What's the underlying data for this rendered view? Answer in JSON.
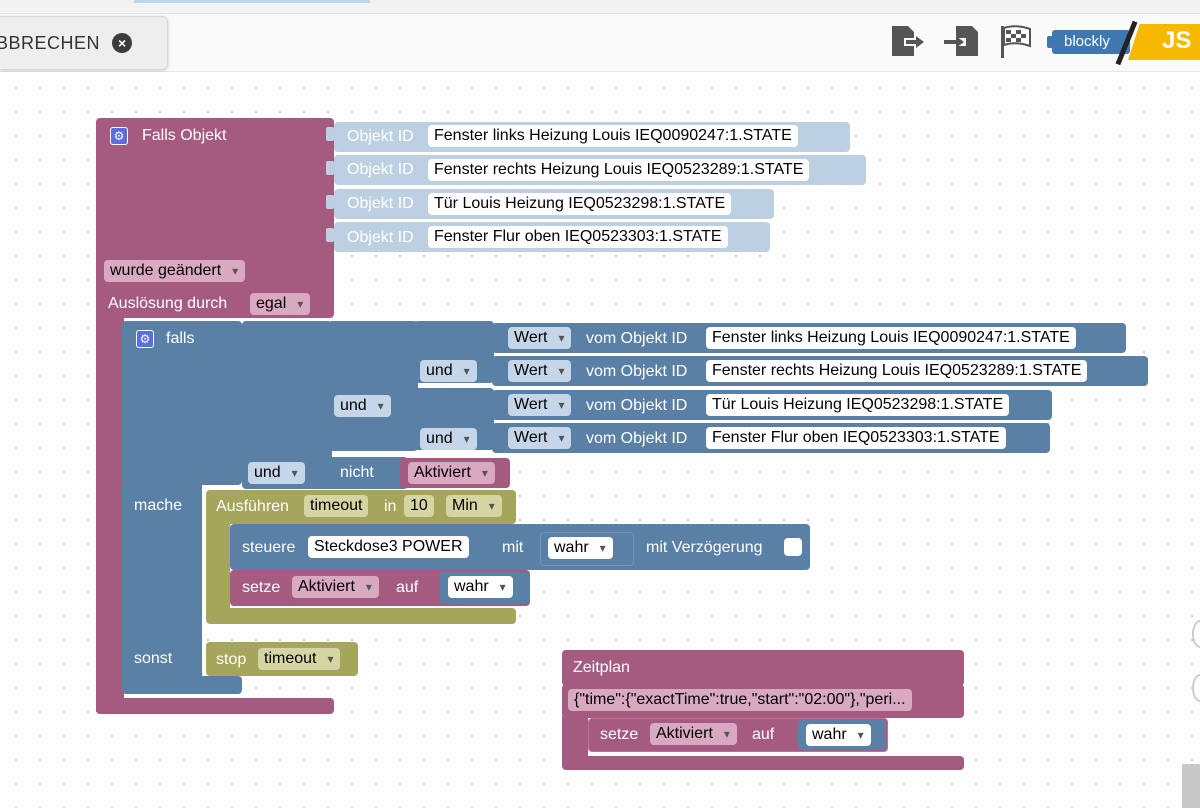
{
  "toolbar": {
    "abort_label": "BBRECHEN",
    "close_icon": "×",
    "icons": [
      "export-icon",
      "import-icon",
      "checkered-flag-icon"
    ],
    "blockly_label": "blockly",
    "js_label": "JS"
  },
  "trigger": {
    "title": "Falls Objekt",
    "object_id_label": "Objekt ID",
    "objects": [
      "Fenster links Heizung Louis IEQ0090247:1.STATE",
      "Fenster rechts Heizung Louis  IEQ0523289:1.STATE",
      "Tür Louis Heizung IEQ0523298:1.STATE",
      "Fenster Flur oben IEQ0523303:1.STATE"
    ],
    "changed_label": "wurde geändert",
    "trigger_by_label": "Auslösung durch",
    "trigger_by_value": "egal"
  },
  "ifblock": {
    "falls_label": "falls",
    "und_label": "und",
    "wert_label": "Wert",
    "vom_label": "vom Objekt ID",
    "rows": [
      "Fenster links Heizung Louis IEQ0090247:1.STATE",
      "Fenster rechts Heizung Louis  IEQ0523289:1.STATE",
      "Tür Louis Heizung IEQ0523298:1.STATE",
      "Fenster Flur oben IEQ0523303:1.STATE"
    ],
    "nicht_label": "nicht",
    "aktiviert_var": "Aktiviert",
    "mache_label": "mache",
    "sonst_label": "sonst"
  },
  "timeout": {
    "run_label": "Ausführen",
    "name": "timeout",
    "in_label": "in",
    "value": "10",
    "unit": "Min"
  },
  "control": {
    "steuere_label": "steuere",
    "device": "Steckdose3 POWER",
    "mit_label": "mit",
    "value": "wahr",
    "delay_label": "mit Verzögerung"
  },
  "setze1": {
    "setze_label": "setze",
    "var": "Aktiviert",
    "auf_label": "auf",
    "value": "wahr"
  },
  "stop": {
    "stop_label": "stop",
    "name": "timeout"
  },
  "schedule": {
    "title": "Zeitplan",
    "spec": "{\"time\":{\"exactTime\":true,\"start\":\"02:00\"},\"peri...",
    "setze_label": "setze",
    "var": "Aktiviert",
    "auf_label": "auf",
    "value": "wahr"
  },
  "colors": {
    "pink": "#a55b80",
    "blue": "#5b80a5",
    "olive": "#a5a55b",
    "objectid": "#bcd0e2"
  }
}
